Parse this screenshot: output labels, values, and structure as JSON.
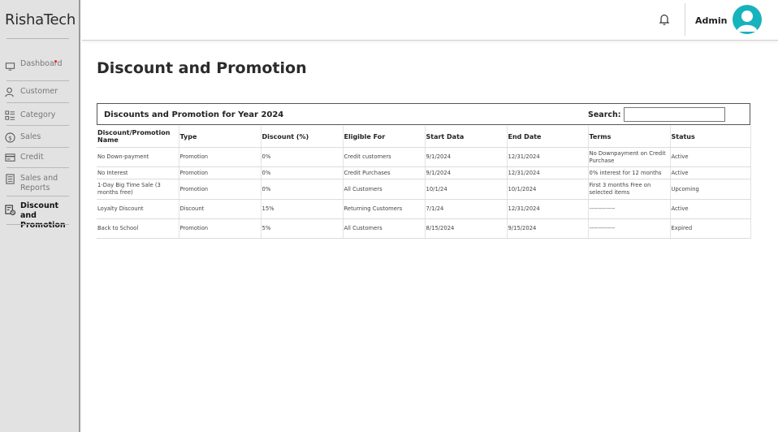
{
  "app": {
    "brand": "RishaTech"
  },
  "sidebar": {
    "items": [
      {
        "label": "Dashboard",
        "icon": "monitor-icon"
      },
      {
        "label": "Customer",
        "icon": "user-icon"
      },
      {
        "label": "Category",
        "icon": "category-icon"
      },
      {
        "label": "Sales",
        "icon": "dollar-icon"
      },
      {
        "label": "Credit",
        "icon": "credit-card-icon"
      },
      {
        "label": "Sales and Reports",
        "icon": "report-icon"
      },
      {
        "label": "Discount and Promotion",
        "icon": "discount-icon",
        "active": true
      }
    ]
  },
  "header": {
    "admin_name": "Admin"
  },
  "page": {
    "title": "Discount and Promotion"
  },
  "panel": {
    "title": "Discounts and Promotion for Year 2024",
    "search_label": "Search:",
    "search_value": ""
  },
  "table": {
    "columns": [
      "Discount/Promotion Name",
      "Type",
      "Discount (%)",
      "Eligible For",
      "Start Data",
      "End Date",
      "Terms",
      "Status"
    ],
    "rows": [
      [
        "No Down-payment",
        "Promotion",
        "0%",
        "Credit customers",
        "9/1/2024",
        "12/31/2024",
        "No Downpayment on Credit Purchase",
        "Active"
      ],
      [
        "No Interest",
        "Promotion",
        "0%",
        "Credit Purchases",
        "9/1/2024",
        "12/31/2024",
        "0% interest for 12 months",
        "Active"
      ],
      [
        "1-Day Big Time Sale (3 months free)",
        "Promotion",
        "0%",
        "All Customers",
        "10/1/24",
        "10/1/2024",
        "First 3 months Free on selected items",
        "Upcoming"
      ],
      [
        "Loyalty Discount",
        "Discount",
        "15%",
        "Returning Customers",
        "7/1/24",
        "12/31/2024",
        "-------------",
        "Active"
      ],
      [
        "Back to School",
        "Promotion",
        "5%",
        "All Customers",
        "8/15/2024",
        "9/15/2024",
        "-------------",
        "Expired"
      ]
    ]
  },
  "colors": {
    "accent": "#16b3bd",
    "sidebar_bg": "#e2e2e2"
  }
}
